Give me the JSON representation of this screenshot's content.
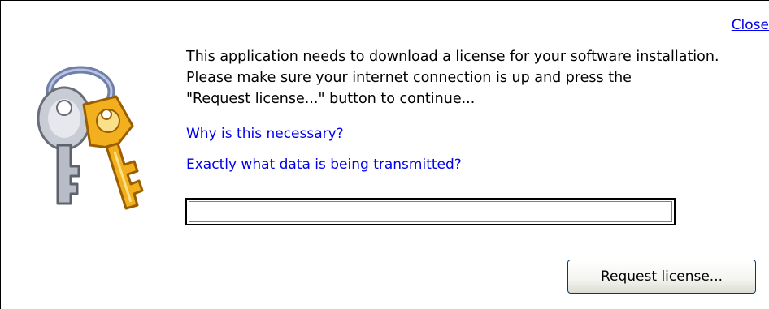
{
  "header": {
    "close_label": "Close"
  },
  "icon": {
    "name": "keys-icon"
  },
  "message": {
    "text": "This application needs to download a license for your software installation.\nPlease make sure your internet connection is up and press the\n\"Request license...\" button to continue..."
  },
  "links": {
    "why_label": "Why is this necessary?",
    "data_label": "Exactly what data is being transmitted?"
  },
  "progress": {
    "value": 0
  },
  "actions": {
    "request_label": "Request license..."
  },
  "colors": {
    "link": "#0000ee",
    "key_gold": "#f2b01e",
    "key_silver": "#c8ccd4",
    "ring": "#8090b8"
  }
}
